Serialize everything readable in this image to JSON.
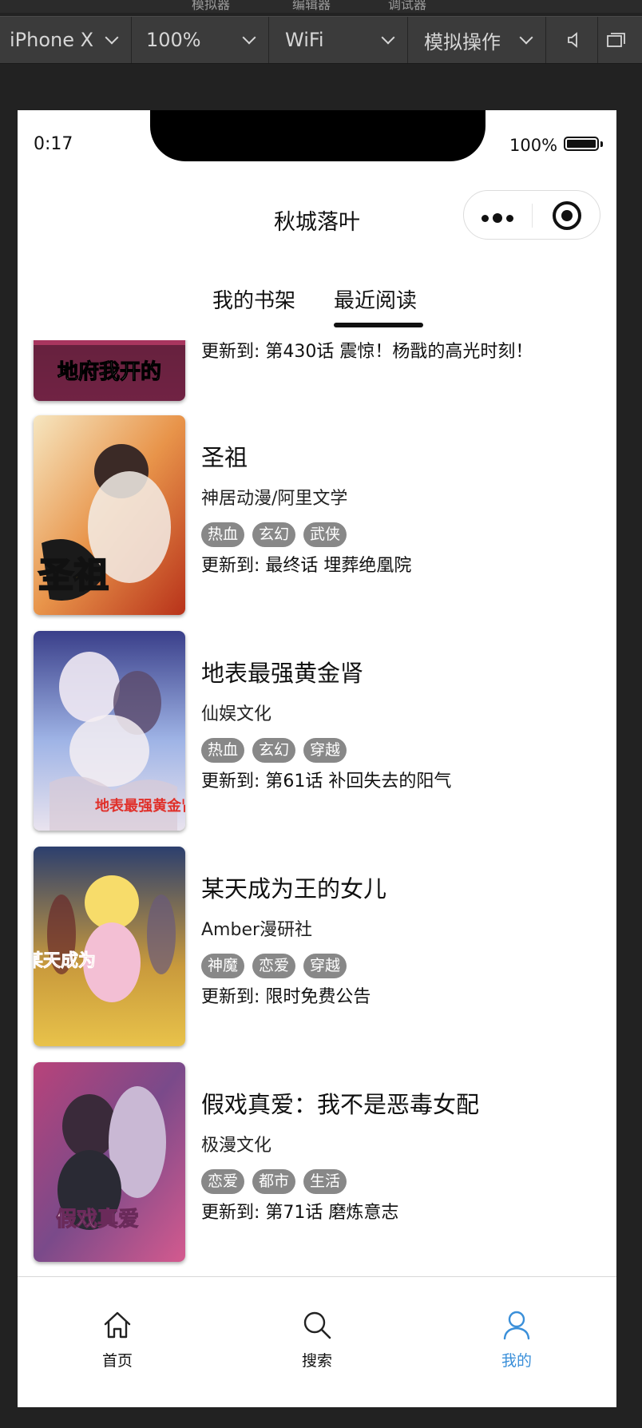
{
  "simulator": {
    "top_labels": [
      "模拟器",
      "编辑器",
      "调试器"
    ],
    "device": "iPhone X",
    "zoom": "100%",
    "network": "WiFi",
    "operation": "模拟操作",
    "icons": [
      "speaker-icon",
      "window-icon"
    ]
  },
  "status_bar": {
    "time": "0:17",
    "battery_text": "100%"
  },
  "nav": {
    "title": "秋城落叶",
    "capsule_icons": [
      "more-dots-icon",
      "target-circle-icon"
    ]
  },
  "tabs": [
    {
      "label": "我的书架",
      "active": false
    },
    {
      "label": "最近阅读",
      "active": true
    }
  ],
  "comics": [
    {
      "cover_text": "地府我开的",
      "update_prefix": "更新到: ",
      "update": "第430话 震惊！杨戬的高光时刻！"
    },
    {
      "title": "圣祖",
      "author": "神居动漫/阿里文学",
      "tags": [
        "热血",
        "玄幻",
        "武侠"
      ],
      "update_prefix": "更新到: ",
      "update": "最终话 埋葬绝凰院",
      "cover_text": "圣祖"
    },
    {
      "title": "地表最强黄金肾",
      "author": "仙娱文化",
      "tags": [
        "热血",
        "玄幻",
        "穿越"
      ],
      "update_prefix": "更新到: ",
      "update": "第61话 补回失去的阳气",
      "cover_text": "地表最强黄金肾"
    },
    {
      "title": "某天成为王的女儿",
      "author": "Amber漫研社",
      "tags": [
        "神魔",
        "恋爱",
        "穿越"
      ],
      "update_prefix": "更新到: ",
      "update": "限时免费公告",
      "cover_text": "某天成为"
    },
    {
      "title": "假戏真爱：我不是恶毒女配",
      "author": "极漫文化",
      "tags": [
        "恋爱",
        "都市",
        "生活"
      ],
      "update_prefix": "更新到: ",
      "update": "第71话 磨炼意志",
      "cover_text": "假戏真爱"
    }
  ],
  "tabbar": [
    {
      "label": "首页",
      "icon": "home-icon",
      "active": false
    },
    {
      "label": "搜索",
      "icon": "search-icon",
      "active": false
    },
    {
      "label": "我的",
      "icon": "user-icon",
      "active": true
    }
  ],
  "colors": {
    "tag_bg": "#888888",
    "active_tab": "#3a8fd9",
    "background": "#222222"
  }
}
